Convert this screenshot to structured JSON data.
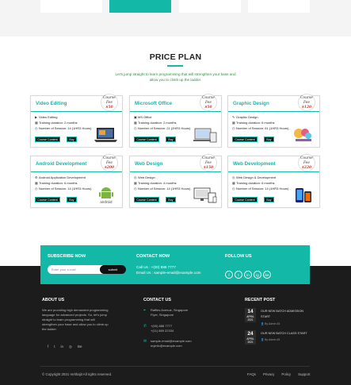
{
  "section": {
    "title": "PRICE PLAN",
    "subtitle": "Let's jump straight to learn programming that will strengthen your base and allow you to climb up the ladder."
  },
  "fee_label_line1": "Course",
  "fee_label_line2": "Fee",
  "cards": [
    {
      "title": "Video Editing",
      "price": "$50",
      "f1": "Video Editing",
      "f2": "Training duration: 2 months",
      "f3": "Number of Session: 14 (1HR3 Hours)",
      "btn1": "Course Content",
      "btn2": "Buy",
      "thumb": "laptop-image"
    },
    {
      "title": "Microsoft Office",
      "price": "$50",
      "f1": "MS Office",
      "f2": "Training duration: 2 months",
      "f3": "Number of Session: 21 (2HR3 Hours)",
      "btn1": "Course Content",
      "btn2": "Buy",
      "thumb": "devices-image"
    },
    {
      "title": "Graphic Design",
      "price": "$120",
      "f1": "Graphic Design",
      "f2": "Training duration: 6 months",
      "f3": "Number of Session: 61 (1HR3 Hours)",
      "btn1": "Course Content",
      "btn2": "Buy",
      "thumb": "creative-design-image"
    },
    {
      "title": "Android Development",
      "price": "$200",
      "f1": "Android Application Development",
      "f2": "Training duration: 6 months",
      "f3": "Number of Session: 14 (1HR3 Hours)",
      "btn1": "Course Content",
      "btn2": "Buy",
      "thumb": "android-logo"
    },
    {
      "title": "Web Design",
      "price": "$150",
      "f1": "Web Design",
      "f2": "Training duration: 4 months",
      "f3": "Number of Session: 14 (1HR3 Hours)",
      "btn1": "Course Content",
      "btn2": "Buy",
      "thumb": "responsive-devices-image"
    },
    {
      "title": "Web Development",
      "price": "$220",
      "f1": "Web Design & Development",
      "f2": "Training duration: 6 months",
      "f3": "Number of Session: 14 (1HR3 Hours)",
      "btn1": "Course Content",
      "btn2": "Buy",
      "thumb": "mobile-devices-image"
    }
  ],
  "subscribe": {
    "title": "SUBSCRIBE NOW",
    "placeholder": "Enter your e-mail",
    "button": "submit"
  },
  "contact_now": {
    "title": "CONTACT NOW",
    "call": "Call Us : +(00) 888 7777",
    "email": "Email Us : sample-email@example.com"
  },
  "follow": {
    "title": "FOLLOW US",
    "icons": [
      "f",
      "t",
      "in",
      "ig",
      "be"
    ]
  },
  "about": {
    "title": "ABOUT US",
    "text": "We are providing high demanded programming language for advanced projects. So, let's jump straight to learn programming that will strengthen your base and allow you to climb up the ladder."
  },
  "contact_us": {
    "title": "CONTACT US",
    "address1": "Raffles Avenue, Singapore",
    "address2": "Flyer, Singapore",
    "phone1": "+(00) 888 7777",
    "phone2": "+(11) 889 22334",
    "email1": "sample-email@example.com",
    "email2": "myinfo@example.com"
  },
  "recent_post": {
    "title": "RECENT POST",
    "posts": [
      {
        "day": "14",
        "month": "APRIL",
        "year": "2021",
        "title1": "OUR NEW BATCH ADMISSION",
        "title2": "START",
        "meta": "By Admin  45"
      },
      {
        "day": "24",
        "month": "APRIL",
        "year": "2021",
        "title1": "OUR NEW BATCH CLASS START",
        "meta": "By Admin  45"
      }
    ]
  },
  "footer": {
    "copyright": "© Copyright 2021 mrithajit All rights reserved.",
    "links": [
      "FAQs",
      "Privacy",
      "Policy",
      "Support"
    ]
  },
  "colors": {
    "accent": "#14b8a6",
    "price": "#e5322d",
    "dark": "#1c1c1c"
  }
}
